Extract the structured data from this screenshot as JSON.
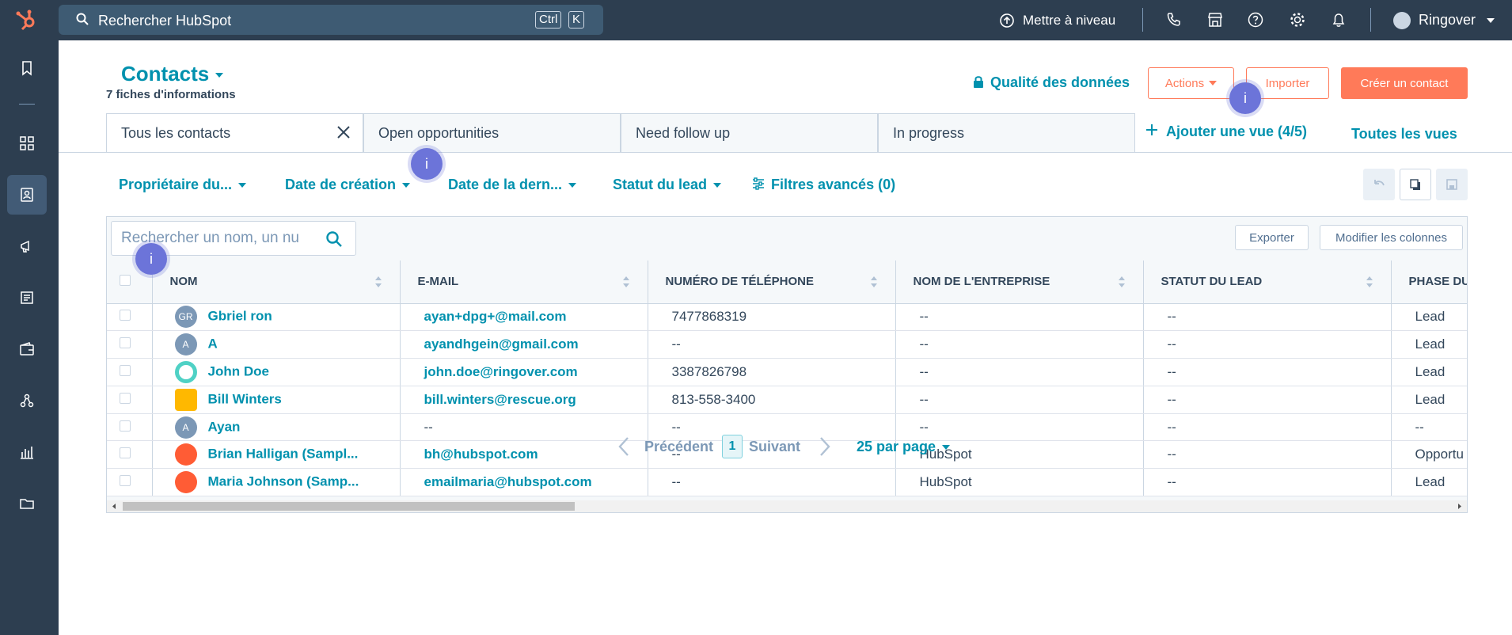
{
  "topbar": {
    "search_placeholder": "Rechercher HubSpot",
    "kbd_ctrl": "Ctrl",
    "kbd_k": "K",
    "upgrade_label": "Mettre à niveau",
    "user_name": "Ringover"
  },
  "header": {
    "title": "Contacts",
    "subtitle": "7 fiches d'informations",
    "quality_label": "Qualité des données",
    "actions_label": "Actions",
    "import_label": "Importer",
    "create_label": "Créer un contact"
  },
  "tabs": [
    {
      "label": "Tous les contacts"
    },
    {
      "label": "Open opportunities"
    },
    {
      "label": "Need follow up"
    },
    {
      "label": "In progress"
    }
  ],
  "add_view_label": "Ajouter une vue (4/5)",
  "all_views_label": "Toutes les vues",
  "filters": {
    "owner": "Propriétaire du...",
    "created": "Date de création",
    "last": "Date de la dern...",
    "lead_status": "Statut du lead",
    "advanced": "Filtres avancés (0)"
  },
  "table": {
    "search_placeholder": "Rechercher un nom, un nu",
    "export_label": "Exporter",
    "columns_label": "Modifier les colonnes",
    "headers": [
      "NOM",
      "E-MAIL",
      "NUMÉRO DE TÉLÉPHONE",
      "NOM DE L'ENTREPRISE",
      "STATUT DU LEAD",
      "PHASE DU"
    ],
    "rows": [
      {
        "initials": "GR",
        "name": "Gbriel ron",
        "email": "ayan+dpg+@mail.com",
        "phone": "7477868319",
        "company": "--",
        "lead_status": "--",
        "phase": "Lead"
      },
      {
        "initials": "A",
        "name": "A",
        "email": "ayandhgein@gmail.com",
        "phone": "--",
        "company": "--",
        "lead_status": "--",
        "phase": "Lead"
      },
      {
        "initials": "",
        "name": "John Doe",
        "email": "john.doe@ringover.com",
        "phone": "3387826798",
        "company": "--",
        "lead_status": "--",
        "phase": "Lead"
      },
      {
        "initials": "",
        "name": "Bill Winters",
        "email": "bill.winters@rescue.org",
        "phone": "813-558-3400",
        "company": "--",
        "lead_status": "--",
        "phase": "Lead"
      },
      {
        "initials": "A",
        "name": "Ayan",
        "email": "--",
        "phone": "--",
        "company": "--",
        "lead_status": "--",
        "phase": "--"
      },
      {
        "initials": "",
        "name": "Brian Halligan (Sampl...",
        "email": "bh@hubspot.com",
        "phone": "--",
        "company": "HubSpot",
        "lead_status": "--",
        "phase": "Opportu"
      },
      {
        "initials": "",
        "name": "Maria Johnson (Samp...",
        "email": "emailmaria@hubspot.com",
        "phone": "--",
        "company": "HubSpot",
        "lead_status": "--",
        "phase": "Lead"
      }
    ]
  },
  "pagination": {
    "prev": "Précédent",
    "page": "1",
    "next": "Suivant",
    "per_page": "25 par page"
  },
  "beacon_label": "i",
  "colors": {
    "accent": "#0091ae",
    "brand": "#ff7a59",
    "nav": "#2d3e50"
  }
}
